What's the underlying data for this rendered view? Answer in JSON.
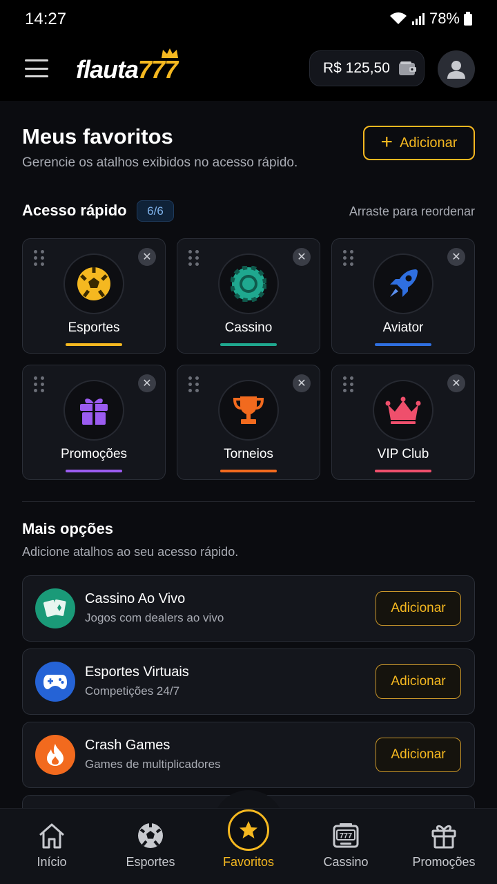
{
  "status_bar": {
    "time": "14:27",
    "battery": "78%"
  },
  "header": {
    "logo_main": "flauta",
    "logo_numbers": "777",
    "balance": "R$ 125,50"
  },
  "page": {
    "title": "Meus favoritos",
    "subtitle": "Gerencie os atalhos exibidos no acesso rápido.",
    "add_button": "Adicionar"
  },
  "quick_access": {
    "title": "Acesso rápido",
    "count": "6/6",
    "hint": "Arraste para reordenar",
    "items": [
      {
        "label": "Esportes",
        "icon": "soccer-ball-icon",
        "color": "#f5b820"
      },
      {
        "label": "Cassino",
        "icon": "casino-chip-icon",
        "color": "#1fa88f"
      },
      {
        "label": "Aviator",
        "icon": "rocket-icon",
        "color": "#2f6fe0"
      },
      {
        "label": "Promoções",
        "icon": "gift-icon",
        "color": "#9b5cf0"
      },
      {
        "label": "Torneios",
        "icon": "trophy-icon",
        "color": "#f26a1e"
      },
      {
        "label": "VIP Club",
        "icon": "crown-icon",
        "color": "#ef4f6c"
      }
    ]
  },
  "more_options": {
    "title": "Mais opções",
    "subtitle": "Adicione atalhos ao seu acesso rápido.",
    "items": [
      {
        "name": "Cassino Ao Vivo",
        "desc": "Jogos com dealers ao vivo",
        "button": "Adicionar",
        "icon": "playing-cards-icon",
        "color": "#1a9a78"
      },
      {
        "name": "Esportes Virtuais",
        "desc": "Competições 24/7",
        "button": "Adicionar",
        "icon": "gamepad-icon",
        "color": "#2563d6"
      },
      {
        "name": "Crash Games",
        "desc": "Games de multiplicadores",
        "button": "Adicionar",
        "icon": "fire-icon",
        "color": "#f26a1e"
      }
    ]
  },
  "bottom_nav": {
    "items": [
      {
        "label": "Início",
        "icon": "home-icon"
      },
      {
        "label": "Esportes",
        "icon": "soccer-ball-icon"
      },
      {
        "label": "Favoritos",
        "icon": "star-icon",
        "active": true
      },
      {
        "label": "Cassino",
        "icon": "slot-machine-icon"
      },
      {
        "label": "Promoções",
        "icon": "gift-icon"
      }
    ]
  },
  "colors": {
    "accent": "#f5b820",
    "background": "#0b0c10",
    "card": "#14161c"
  }
}
